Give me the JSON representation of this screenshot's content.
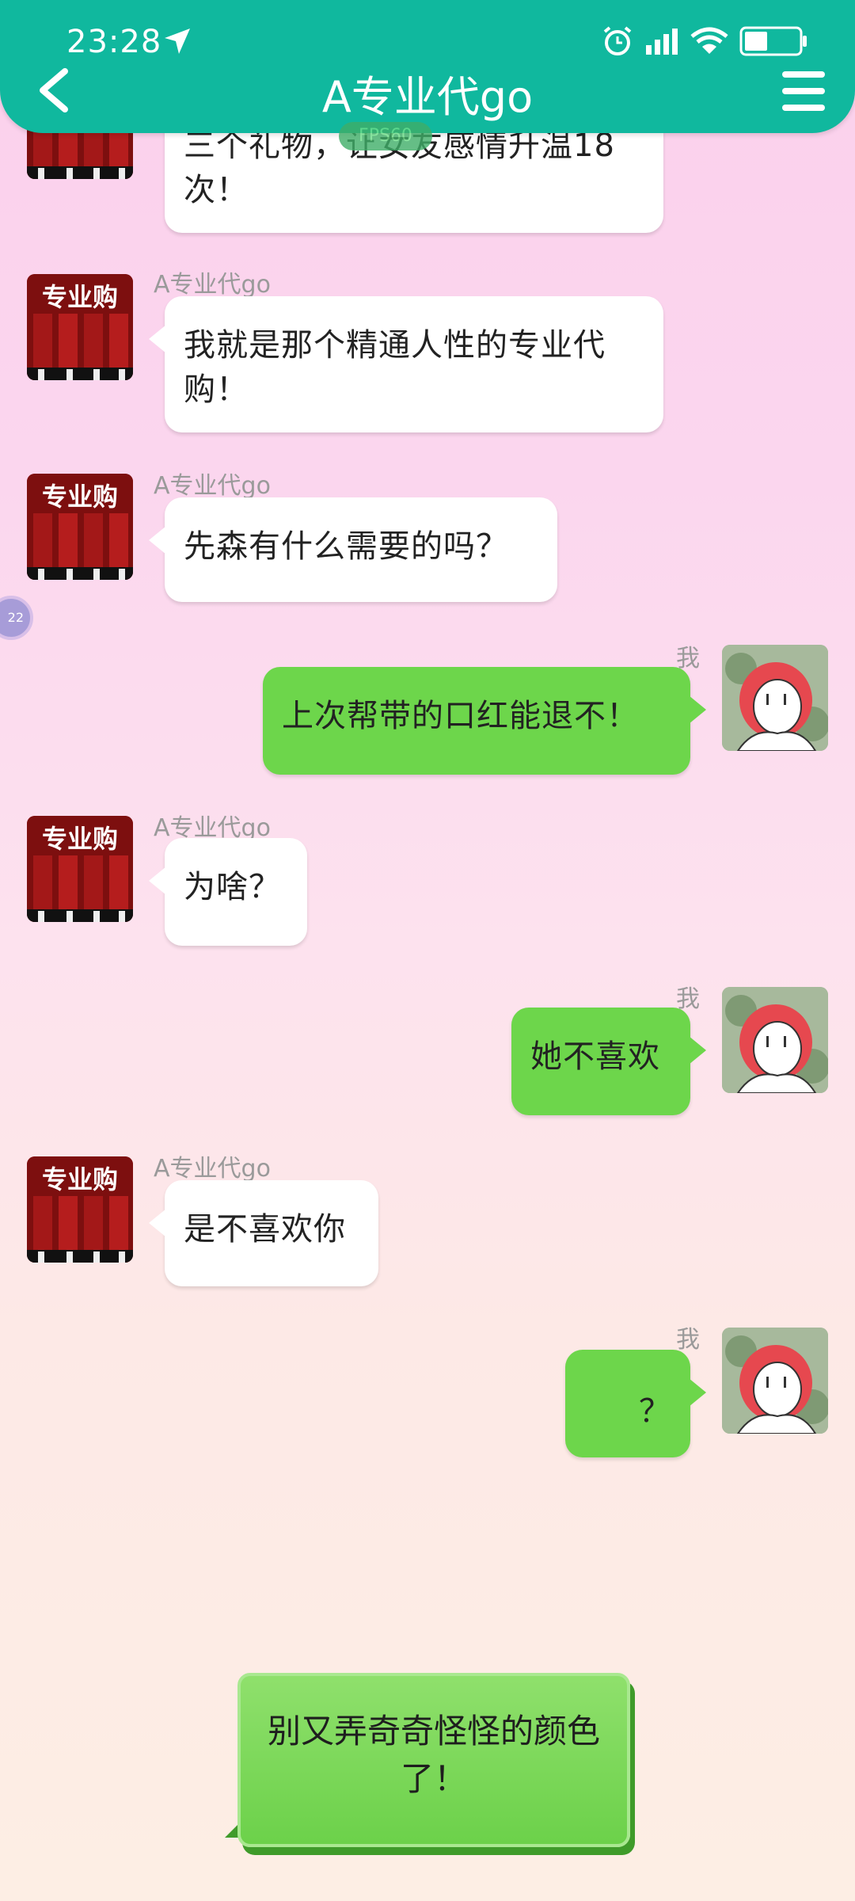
{
  "status_bar": {
    "time": "23:28"
  },
  "header": {
    "title": "A专业代go",
    "badge": "FPS60"
  },
  "floating_ball": {
    "text": "22"
  },
  "shop_avatar_text": "专业购",
  "messages": [
    {
      "side": "left",
      "sender": "",
      "text": "三个礼物，让女友感情升温18次！"
    },
    {
      "side": "left",
      "sender": "A专业代go",
      "text": "我就是那个精通人性的专业代购！"
    },
    {
      "side": "left",
      "sender": "A专业代go",
      "text": "先森有什么需要的吗？"
    },
    {
      "side": "right",
      "sender": "我",
      "text": "上次帮带的口红能退不！"
    },
    {
      "side": "left",
      "sender": "A专业代go",
      "text": "为啥？"
    },
    {
      "side": "right",
      "sender": "我",
      "text": "她不喜欢"
    },
    {
      "side": "left",
      "sender": "A专业代go",
      "text": "是不喜欢你"
    },
    {
      "side": "right",
      "sender": "我",
      "text": "？"
    }
  ],
  "reply_option": {
    "text": "别又弄奇奇怪怪的颜色了！"
  }
}
